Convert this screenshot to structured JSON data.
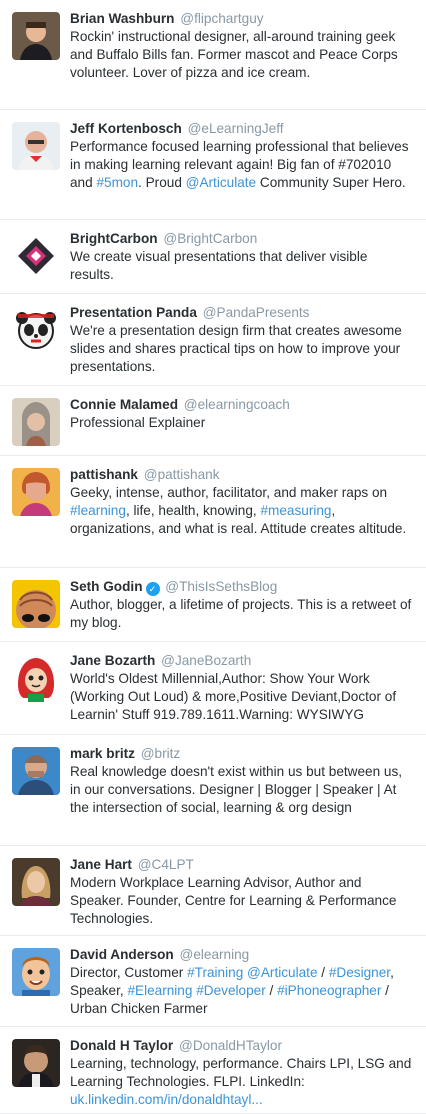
{
  "users": [
    {
      "name": "Brian Washburn",
      "handle": "@flipchartguy",
      "verified": false,
      "bio": [
        {
          "t": "Rockin' instructional designer, all-around training geek and Buffalo Bills fan. Former mascot and Peace Corps volunteer. Lover of pizza and ice cream."
        }
      ]
    },
    {
      "name": "Jeff Kortenbosch",
      "handle": "@eLearningJeff",
      "verified": false,
      "bio": [
        {
          "t": "Performance focused learning professional that believes in making learning relevant again! Big fan of #702010 and "
        },
        {
          "t": "#5mon",
          "link": true
        },
        {
          "t": ". Proud "
        },
        {
          "t": "@Articulate",
          "link": true
        },
        {
          "t": " Community Super Hero."
        }
      ]
    },
    {
      "name": "BrightCarbon",
      "handle": "@BrightCarbon",
      "verified": false,
      "bio": [
        {
          "t": "We create visual presentations that deliver visible results."
        }
      ]
    },
    {
      "name": "Presentation Panda",
      "handle": "@PandaPresents",
      "verified": false,
      "bio": [
        {
          "t": "We're a presentation design firm that creates awesome slides and shares practical tips on how to improve your presentations."
        }
      ]
    },
    {
      "name": "Connie Malamed",
      "handle": "@elearningcoach",
      "verified": false,
      "bio": [
        {
          "t": "Professional Explainer"
        }
      ]
    },
    {
      "name": "pattishank",
      "handle": "@pattishank",
      "verified": false,
      "bio": [
        {
          "t": "Geeky, intense, author, facilitator, and maker raps on "
        },
        {
          "t": "#learning",
          "link": true
        },
        {
          "t": ", life, health, knowing, "
        },
        {
          "t": "#measuring",
          "link": true
        },
        {
          "t": ", organizations, and what is real. Attitude creates altitude."
        }
      ]
    },
    {
      "name": "Seth Godin",
      "handle": "@ThisIsSethsBlog",
      "verified": true,
      "bio": [
        {
          "t": "Author, blogger, a lifetime of projects. This is a retweet of my blog."
        }
      ]
    },
    {
      "name": "Jane Bozarth",
      "handle": "@JaneBozarth",
      "verified": false,
      "bio": [
        {
          "t": "World's Oldest Millennial,Author: Show Your Work (Working Out Loud) & more,Positive Deviant,Doctor of Learnin' Stuff 919.789.1611.Warning: WYSIWYG"
        }
      ]
    },
    {
      "name": "mark britz",
      "handle": "@britz",
      "verified": false,
      "bio": [
        {
          "t": "Real knowledge doesn't exist within us but between us, in our conversations. Designer | Blogger | Speaker | At the intersection of social, learning & org design"
        }
      ]
    },
    {
      "name": "Jane Hart",
      "handle": "@C4LPT",
      "verified": false,
      "bio": [
        {
          "t": "Modern Workplace Learning Advisor, Author and Speaker. Founder, Centre for Learning & Performance Technologies."
        }
      ]
    },
    {
      "name": "David Anderson",
      "handle": "@elearning",
      "verified": false,
      "bio": [
        {
          "t": "Director, Customer "
        },
        {
          "t": "#Training",
          "link": true
        },
        {
          "t": " "
        },
        {
          "t": "@Articulate",
          "link": true
        },
        {
          "t": " / "
        },
        {
          "t": "#Designer",
          "link": true
        },
        {
          "t": ", Speaker, "
        },
        {
          "t": "#Elearning",
          "link": true
        },
        {
          "t": " "
        },
        {
          "t": "#Developer",
          "link": true
        },
        {
          "t": " / "
        },
        {
          "t": "#iPhoneographer",
          "link": true
        },
        {
          "t": " / Urban Chicken Farmer"
        }
      ]
    },
    {
      "name": "Donald H Taylor",
      "handle": "@DonaldHTaylor",
      "verified": false,
      "bio": [
        {
          "t": "Learning, technology, performance. Chairs LPI, LSG and Learning Technologies. FLPI. LinkedIn: "
        },
        {
          "t": "uk.linkedin.com/in/donaldhtayl...",
          "link": true
        }
      ]
    }
  ],
  "colors": {
    "link": "#3b94d9",
    "handle": "#8899a6",
    "verified": "#1da1f2"
  }
}
